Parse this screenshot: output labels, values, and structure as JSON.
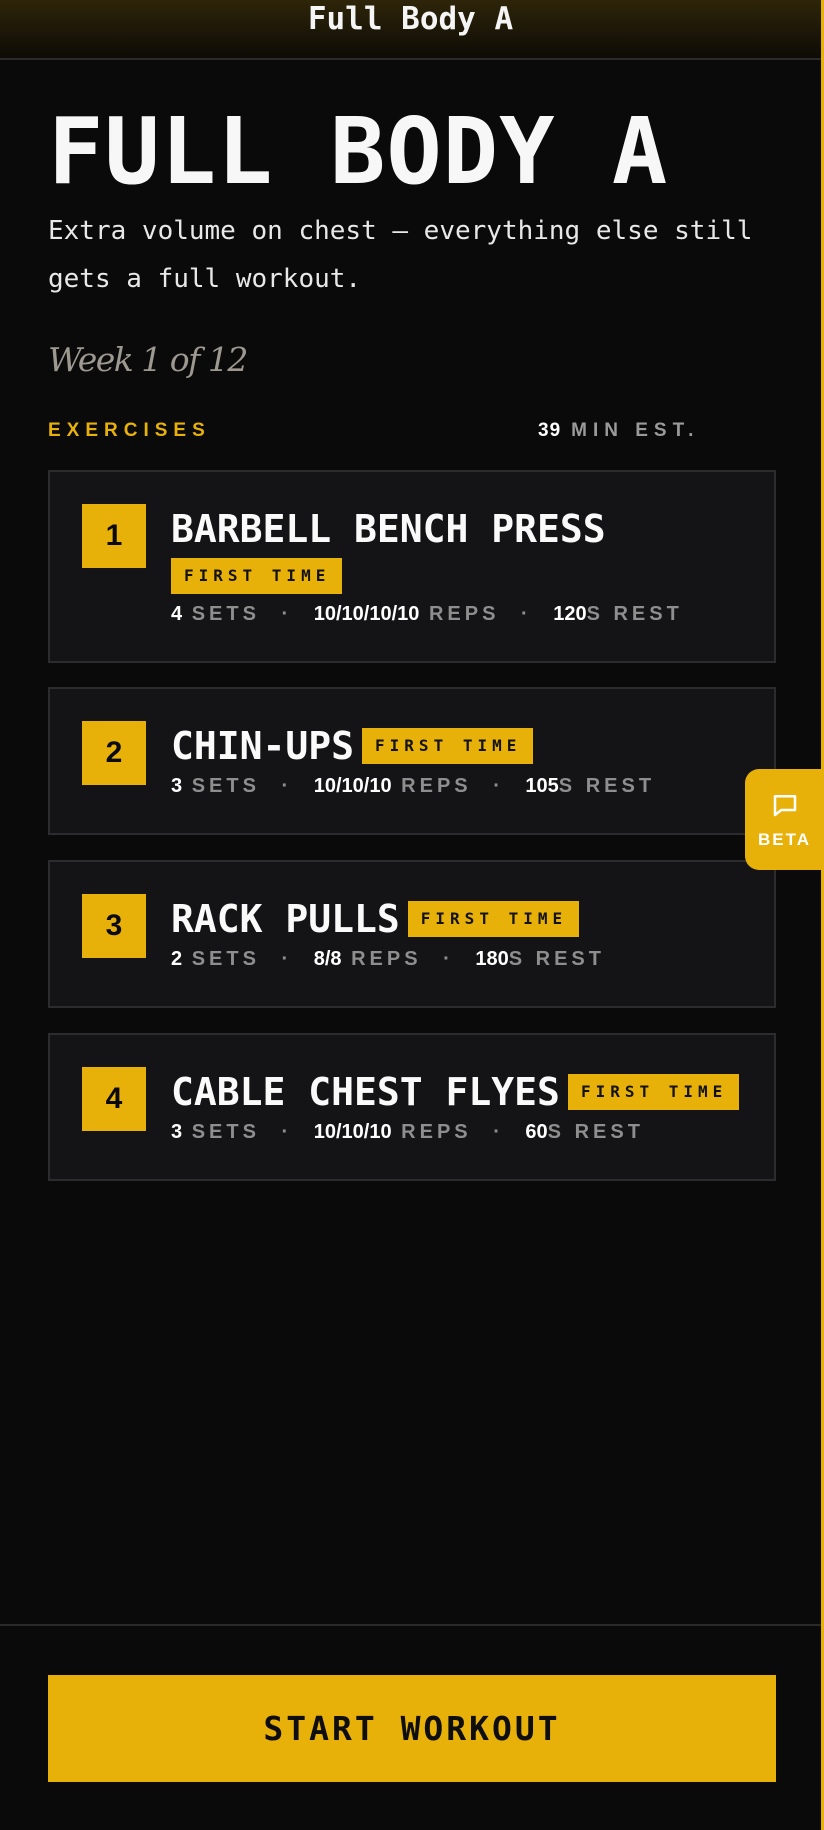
{
  "header": {
    "title": "Full Body A"
  },
  "workout": {
    "title": "FULL BODY A",
    "description": "Extra volume on chest — everything else still gets a full workout.",
    "week": "Week 1 of 12"
  },
  "section": {
    "label": "EXERCISES",
    "est_value": "39",
    "est_suffix": "MIN EST."
  },
  "exercises": [
    {
      "number": "1",
      "name": "BARBELL BENCH PRESS",
      "badge": "FIRST TIME",
      "sets": "4",
      "sets_label": "SETS",
      "reps": "10/10/10/10",
      "reps_label": "REPS",
      "rest": "120",
      "rest_label": "S REST"
    },
    {
      "number": "2",
      "name": "CHIN-UPS",
      "badge": "FIRST TIME",
      "sets": "3",
      "sets_label": "SETS",
      "reps": "10/10/10",
      "reps_label": "REPS",
      "rest": "105",
      "rest_label": "S REST"
    },
    {
      "number": "3",
      "name": "RACK PULLS",
      "badge": "FIRST TIME",
      "sets": "2",
      "sets_label": "SETS",
      "reps": "8/8",
      "reps_label": "REPS",
      "rest": "180",
      "rest_label": "S REST"
    },
    {
      "number": "4",
      "name": "CABLE CHEST FLYES",
      "badge": "FIRST TIME",
      "sets": "3",
      "sets_label": "SETS",
      "reps": "10/10/10",
      "reps_label": "REPS",
      "rest": "60",
      "rest_label": "S REST"
    }
  ],
  "separator": "·",
  "beta": {
    "label": "BETA",
    "icon": "chat-bubble-icon"
  },
  "footer": {
    "start_label": "START WORKOUT"
  },
  "colors": {
    "accent": "#e8b10a",
    "background": "#0a0a0a",
    "card": "#141416"
  }
}
